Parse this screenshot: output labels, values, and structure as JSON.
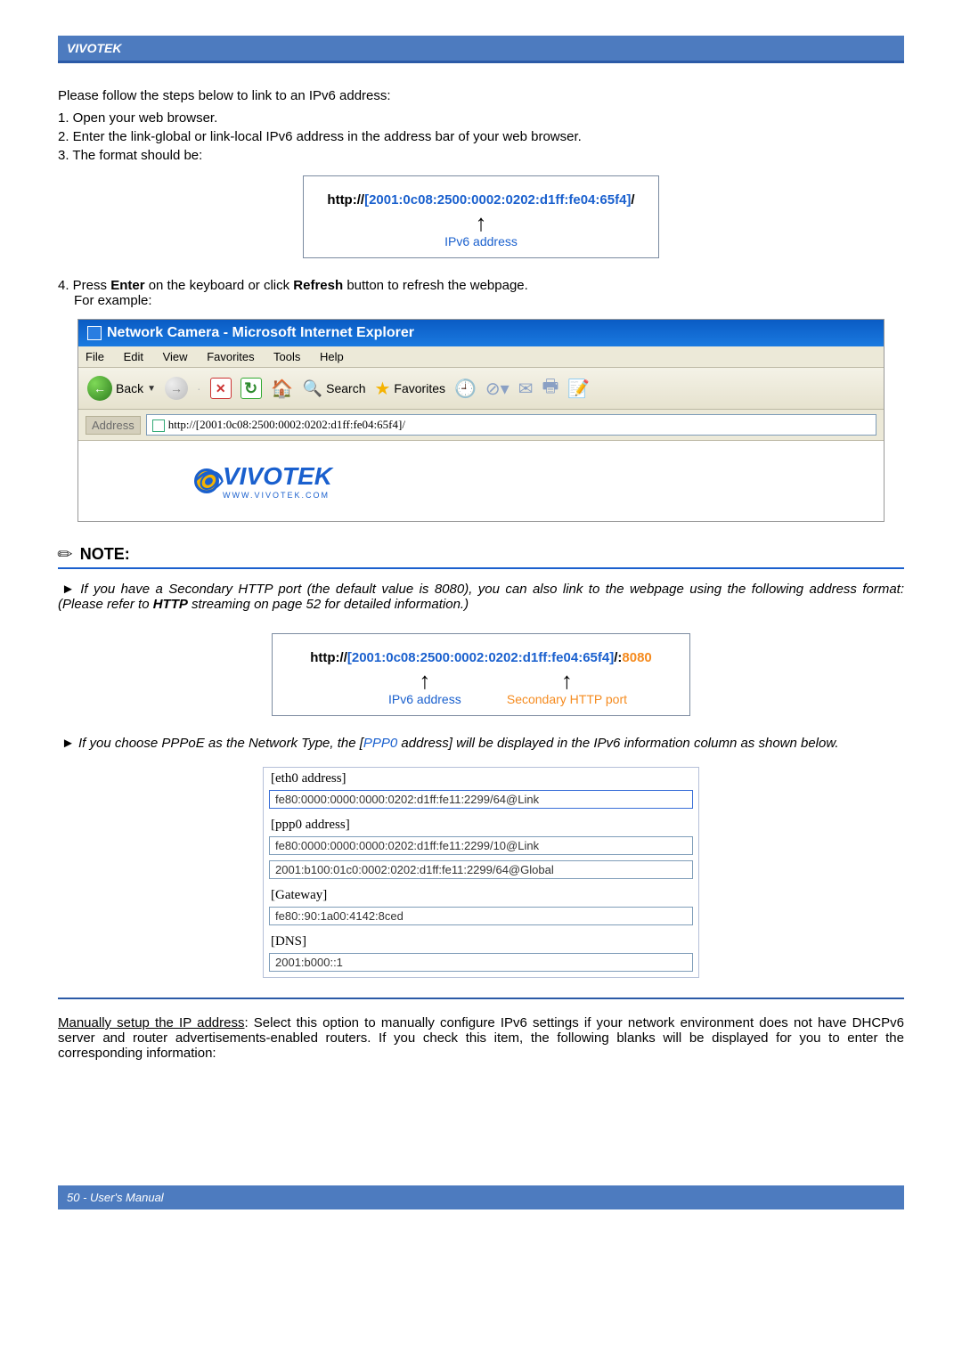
{
  "header": {
    "brand": "VIVOTEK"
  },
  "intro": {
    "lead": "Please follow the steps below to link to an IPv6 address:",
    "s1": "1. Open your web browser.",
    "s2": "2. Enter the link-global or link-local IPv6 address in the address bar of your web browser.",
    "s3": "3. The format should be:"
  },
  "urlbox1": {
    "prefix": "http://",
    "bracket_open": "[",
    "addr": "2001:0c08:2500:0002:0202:d1ff:fe04:65f4",
    "bracket_close": "]",
    "suffix": "/",
    "label": "IPv6 address"
  },
  "step4": {
    "line1_a": "4. Press ",
    "line1_b": "Enter",
    "line1_c": " on the keyboard or click ",
    "line1_d": "Refresh",
    "line1_e": " button to refresh the webpage.",
    "line2": "For example:"
  },
  "ie": {
    "title": "Network Camera - Microsoft Internet Explorer",
    "menu": {
      "file": "File",
      "edit": "Edit",
      "view": "View",
      "fav": "Favorites",
      "tools": "Tools",
      "help": "Help"
    },
    "toolbar": {
      "back": "Back",
      "search": "Search",
      "favorites": "Favorites"
    },
    "address_label": "Address",
    "address_value": "http://[2001:0c08:2500:0002:0202:d1ff:fe04:65f4]/",
    "logo_text": "VIVOTEK",
    "logo_sub": "WWW.VIVOTEK.COM"
  },
  "note": {
    "label": "NOTE:",
    "p1_a": "► If you have a Secondary HTTP port (the default value is 8080), you can also link to the webpage using the following address format: (Please refer to ",
    "p1_b": "HTTP",
    "p1_c": " streaming on page 52 for detailed information.)",
    "p2_a": "► If you choose PPPoE as the Network Type, the [",
    "p2_b": "PPP0",
    "p2_c": " address] will be displayed in the IPv6 information column as shown below."
  },
  "urlbox2": {
    "prefix": "http://",
    "bracket_open": "[",
    "addr": "2001:0c08:2500:0002:0202:d1ff:fe04:65f4",
    "bracket_close": "]",
    "sep": "/:",
    "port": "8080",
    "label_addr": "IPv6 address",
    "label_port": "Secondary HTTP port"
  },
  "ipv6info": {
    "eth0_lbl": "[eth0 address]",
    "eth0_val": "fe80:0000:0000:0000:0202:d1ff:fe11:2299/64@Link",
    "ppp0_lbl": "[ppp0 address]",
    "ppp0_val1": "fe80:0000:0000:0000:0202:d1ff:fe11:2299/10@Link",
    "ppp0_val2": "2001:b100:01c0:0002:0202:d1ff:fe11:2299/64@Global",
    "gw_lbl": "[Gateway]",
    "gw_val": "fe80::90:1a00:4142:8ced",
    "dns_lbl": "[DNS]",
    "dns_val": "2001:b000::1"
  },
  "manual": {
    "ul": "Manually setup the IP address",
    "rest": ": Select this option to manually configure IPv6 settings if your network environment does not have DHCPv6 server and router advertisements-enabled routers. If you check this item, the following blanks will be displayed for you to enter the corresponding information:"
  },
  "footer": {
    "text": "50 - User's Manual"
  }
}
